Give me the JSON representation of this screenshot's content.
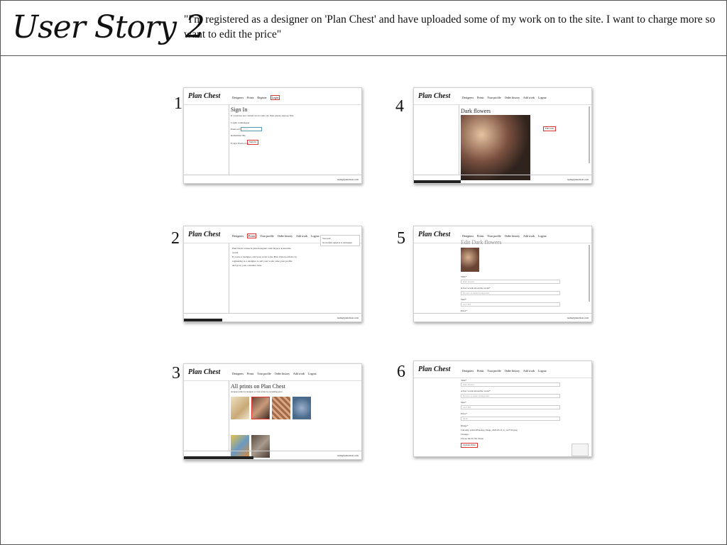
{
  "header": {
    "title": "User Story 2",
    "quote": "\"I'm registered as a designer on 'Plan Chest' and have uploaded some of my work on to the site. I want to charge more so want to edit the price\""
  },
  "numbers": [
    "1",
    "2",
    "3",
    "4",
    "5",
    "6"
  ],
  "thumb": {
    "logo": "Plan Chest",
    "email": "team@planchest.com",
    "nav_anon": [
      "Designers",
      "Prints",
      "Register",
      "Login"
    ],
    "nav_user": [
      "Designers",
      "Prints",
      "Your profile",
      "Order history",
      "Add work",
      "Logout"
    ]
  },
  "thumb1": {
    "heading": "Sign In",
    "intro": "If you have not created an account yet, then please sign up first.",
    "login": "Login: reddesigner",
    "password_label": "Password",
    "password_value": "••••••••",
    "remember": "Remember Me",
    "forgot": "Forgot Password?",
    "sign_in": "Sign In"
  },
  "thumb2": {
    "line1": "Plan Chest connects print designers with buyers around the",
    "line2": "world.",
    "line3": "If you're a designer, add your work to the Plan Chest portfolio by",
    "line4": "registering as a designer to sell your work, raise your profile",
    "line5": "and grow your customer base.",
    "alert_title": "Success!",
    "alert_text": "Successfully signed in as reddesigner."
  },
  "thumb3": {
    "heading": "All prints on Plan Chest",
    "sub": "Arrange prints by designer or view prints by ascending price"
  },
  "thumb4": {
    "heading": "Dark flowers",
    "edit": "Edit work"
  },
  "thumb5": {
    "heading": "Edit Dark flowers",
    "title_label": "Title*",
    "title_value": "Dark flowers",
    "words_label": "A few words about the work*",
    "words_value": "Flowers on darker background",
    "size_label": "Size*",
    "size_value": "A4 x 3M",
    "price_label": "Price*"
  },
  "thumb6": {
    "title_label": "Title*",
    "title_value": "Dark flowers",
    "words_label": "A few words about the work*",
    "words_value": "Flowers on darker background",
    "size_label": "Size*",
    "size_value": "A4 x 3M",
    "price_label": "Price*",
    "price_value": "30.00",
    "image_label": "Image*",
    "currently": "Currently: prints/WhatsApp_Image_2020-05-16_at_14.07.02.jpeg",
    "change": "Change:",
    "choose": "Choose file   No file chosen",
    "update": "Update Print"
  }
}
